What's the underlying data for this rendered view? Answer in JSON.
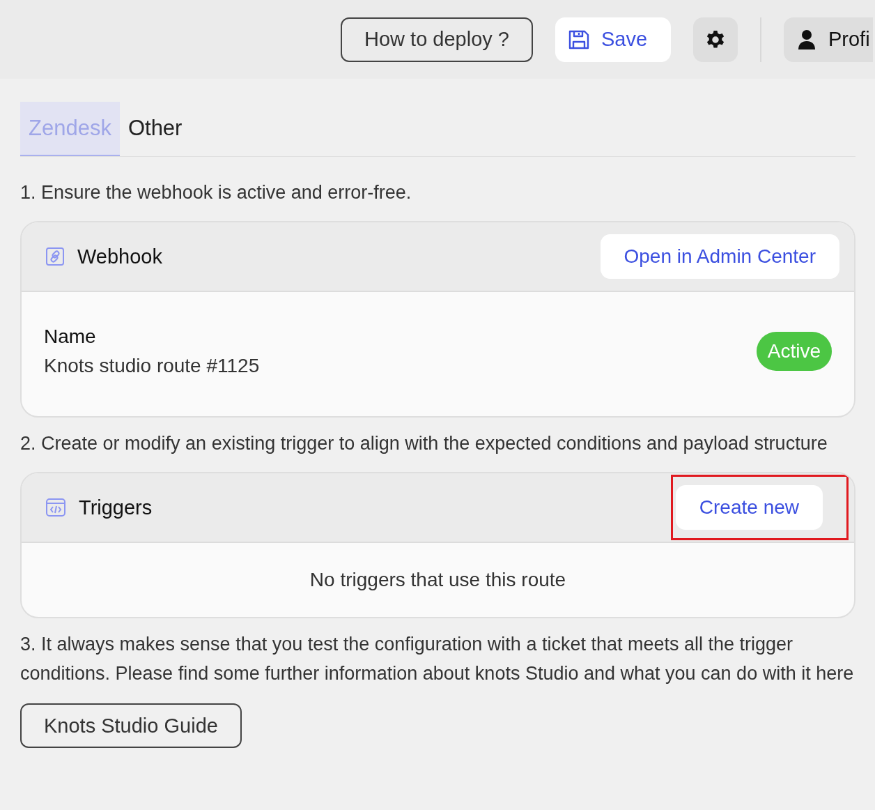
{
  "toolbar": {
    "deploy_button": "How to deploy ?",
    "save_button": "Save",
    "profile_button": "Profi"
  },
  "tabs": [
    {
      "label": "Zendesk",
      "selected": true
    },
    {
      "label": "Other",
      "selected": false
    }
  ],
  "steps": [
    {
      "kind": "card",
      "text": "1. Ensure the webhook is active and error-free.",
      "card": {
        "kind": "status",
        "title": "Webhook",
        "action": "Open in Admin Center",
        "highlighted": false,
        "field_label": "Name",
        "field_value": "Knots studio route #1125",
        "status": "Active",
        "active": true
      }
    },
    {
      "kind": "card",
      "text": "2. Create or modify an existing trigger to align with the expected conditions and payload structure",
      "card": {
        "kind": "list",
        "title": "Triggers",
        "action": "Create new",
        "highlighted": true,
        "empty_text": "No triggers that use this route"
      }
    },
    {
      "kind": "button",
      "text": "3. It always makes sense that you test the configuration with a ticket that meets all the trigger conditions. Please find some further information about knots Studio and what you can do with it here",
      "button": "Knots Studio Guide"
    }
  ]
}
